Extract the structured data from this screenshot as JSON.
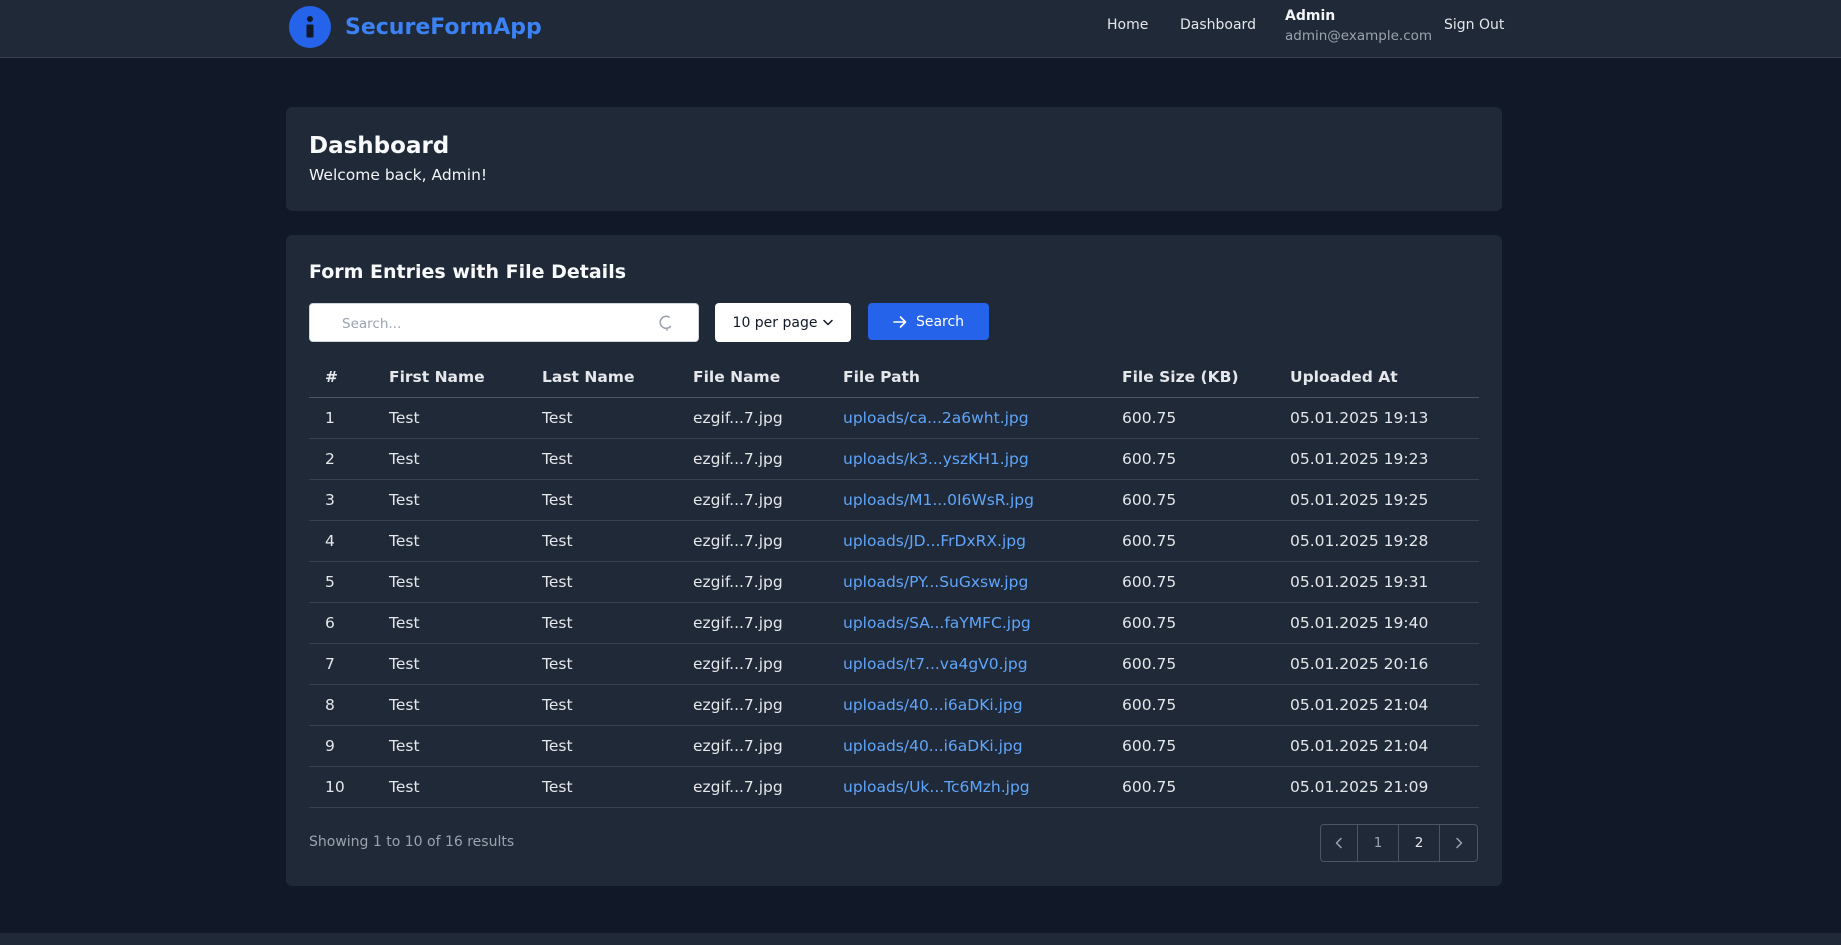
{
  "colors": {
    "accent": "#2563eb",
    "link": "#60a5fa",
    "background": "#111827",
    "card": "#1f2937"
  },
  "brand": {
    "name": "SecureFormApp",
    "logo_icon": "info-icon"
  },
  "nav": {
    "home": "Home",
    "dashboard": "Dashboard",
    "user_name": "Admin",
    "user_email": "admin@example.com",
    "sign_out": "Sign Out"
  },
  "dashboard": {
    "title": "Dashboard",
    "subtitle": "Welcome back, Admin!"
  },
  "entries": {
    "title": "Form Entries with File Details",
    "search_placeholder": "Search...",
    "search_icon": "loading-spinner-icon",
    "per_page": "10 per page",
    "search_button": "Search",
    "search_button_icon": "arrow-right-icon",
    "columns": [
      "#",
      "First Name",
      "Last Name",
      "File Name",
      "File Path",
      "File Size (KB)",
      "Uploaded At"
    ],
    "rows": [
      [
        "1",
        "Test",
        "Test",
        "ezgif...7.jpg",
        "uploads/ca...2a6wht.jpg",
        "600.75",
        "05.01.2025 19:13"
      ],
      [
        "2",
        "Test",
        "Test",
        "ezgif...7.jpg",
        "uploads/k3...yszKH1.jpg",
        "600.75",
        "05.01.2025 19:23"
      ],
      [
        "3",
        "Test",
        "Test",
        "ezgif...7.jpg",
        "uploads/M1...0I6WsR.jpg",
        "600.75",
        "05.01.2025 19:25"
      ],
      [
        "4",
        "Test",
        "Test",
        "ezgif...7.jpg",
        "uploads/JD...FrDxRX.jpg",
        "600.75",
        "05.01.2025 19:28"
      ],
      [
        "5",
        "Test",
        "Test",
        "ezgif...7.jpg",
        "uploads/PY...SuGxsw.jpg",
        "600.75",
        "05.01.2025 19:31"
      ],
      [
        "6",
        "Test",
        "Test",
        "ezgif...7.jpg",
        "uploads/SA...faYMFC.jpg",
        "600.75",
        "05.01.2025 19:40"
      ],
      [
        "7",
        "Test",
        "Test",
        "ezgif...7.jpg",
        "uploads/t7...va4gV0.jpg",
        "600.75",
        "05.01.2025 20:16"
      ],
      [
        "8",
        "Test",
        "Test",
        "ezgif...7.jpg",
        "uploads/40...i6aDKi.jpg",
        "600.75",
        "05.01.2025 21:04"
      ],
      [
        "9",
        "Test",
        "Test",
        "ezgif...7.jpg",
        "uploads/40...i6aDKi.jpg",
        "600.75",
        "05.01.2025 21:04"
      ],
      [
        "10",
        "Test",
        "Test",
        "ezgif...7.jpg",
        "uploads/Uk...Tc6Mzh.jpg",
        "600.75",
        "05.01.2025 21:09"
      ]
    ],
    "showing": "Showing 1 to 10 of 16 results",
    "pages": [
      "1",
      "2"
    ],
    "prev_icon": "chevron-left-icon",
    "next_icon": "chevron-right-icon"
  }
}
